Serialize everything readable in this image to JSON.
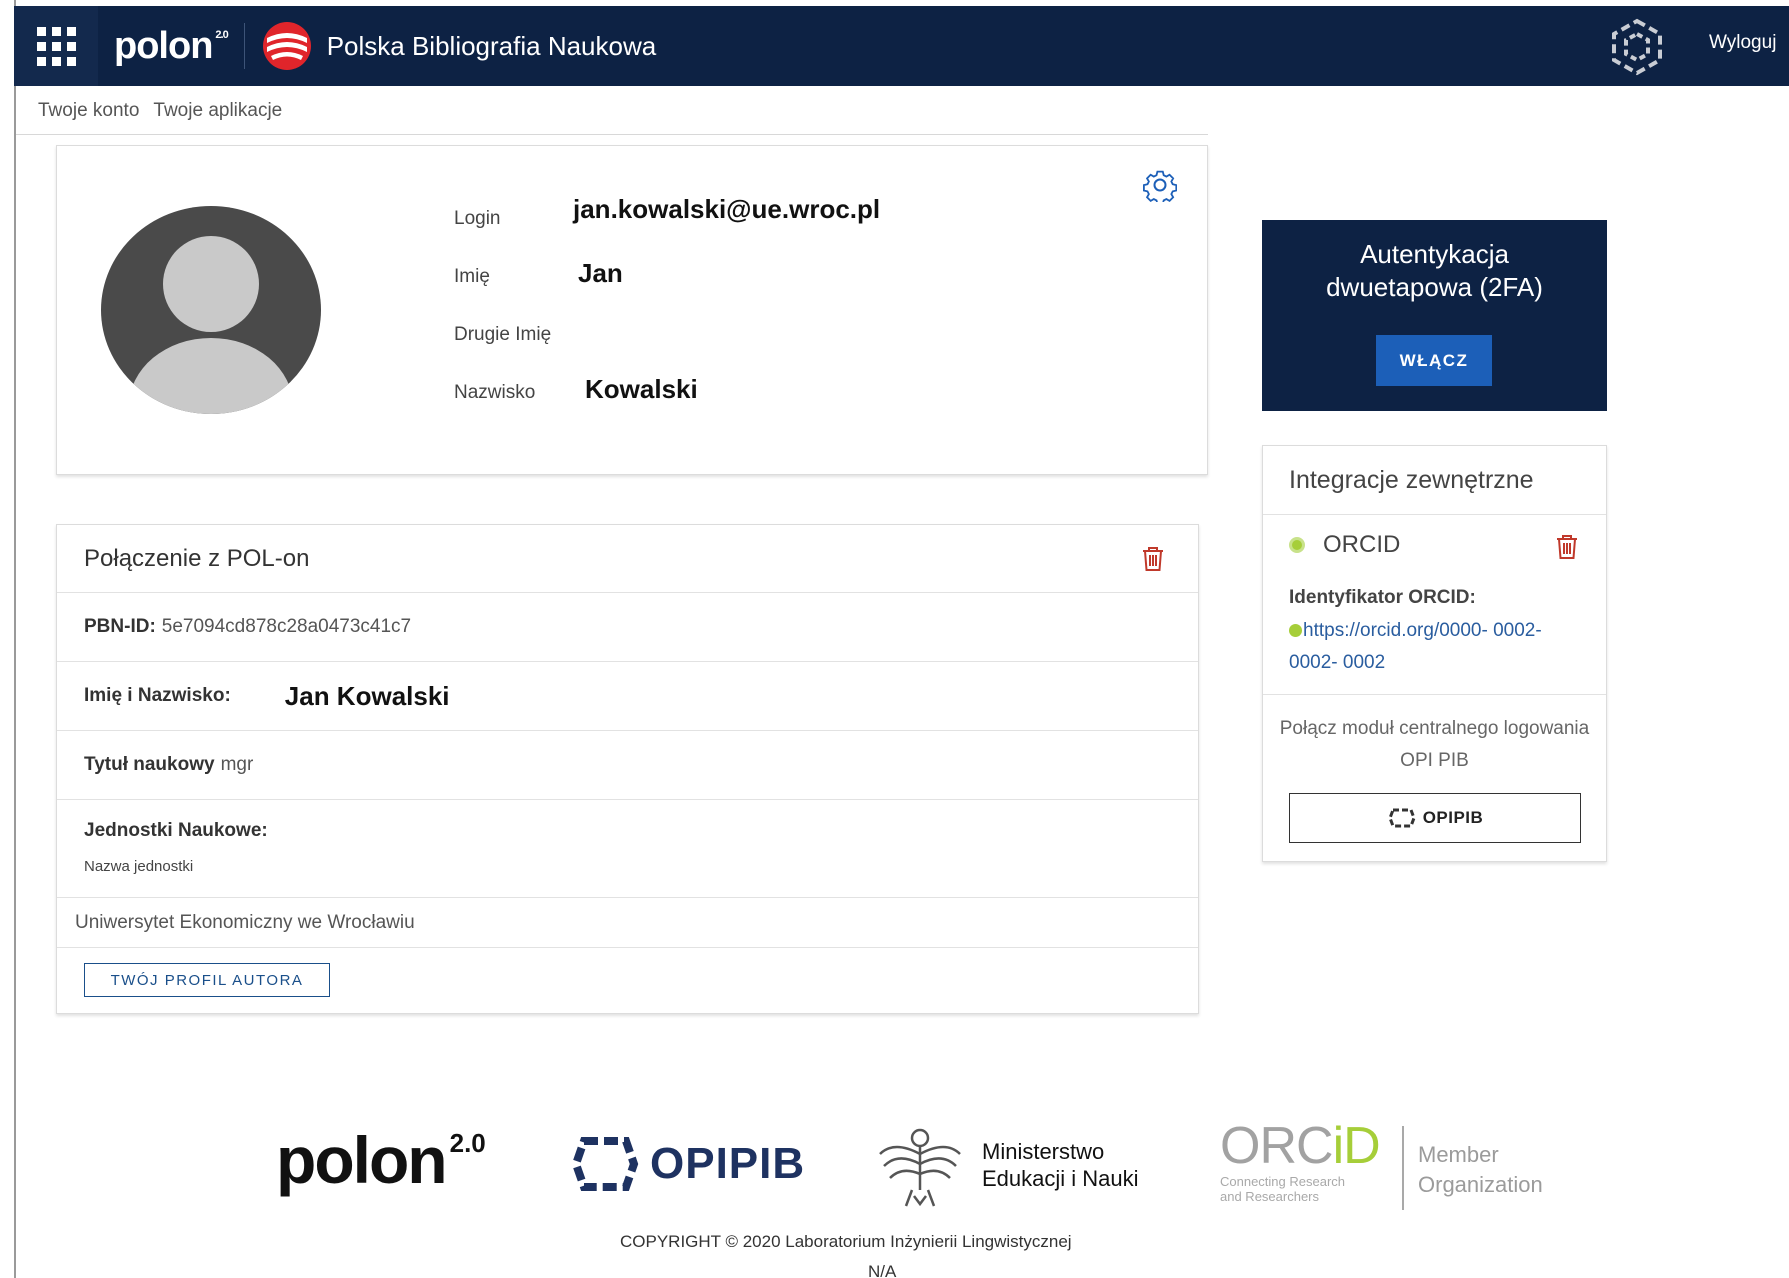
{
  "topbar": {
    "app_logo": "polon",
    "app_logo_version": "2.0",
    "title": "Polska Bibliografia Naukowa",
    "logout_label": "Wyloguj",
    "bg_color": "#0d2244"
  },
  "breadcrumb": [
    "Twoje konto",
    "Twoje aplikacje"
  ],
  "profile": {
    "login_label": "Login",
    "login_value": "jan.kowalski@ue.wroc.pl",
    "first_name_label": "Imię",
    "first_name_value": "Jan",
    "middle_name_label": "Drugie Imię",
    "middle_name_value": "",
    "last_name_label": "Nazwisko",
    "last_name_value": "Kowalski"
  },
  "polon_connection": {
    "title": "Połączenie z POL-on",
    "pbn_id_label": "PBN-ID:",
    "pbn_id_value": "5e7094cd878c28a0473c41c7",
    "full_name_label": "Imię i Nazwisko:",
    "full_name_value": "Jan Kowalski",
    "degree_label": "Tytuł naukowy",
    "degree_value": "mgr",
    "units_label": "Jednostki Naukowe:",
    "units_column": "Nazwa jednostki",
    "unit_name": "Uniwersytet Ekonomiczny we Wrocławiu",
    "profile_button": "TWÓJ PROFIL AUTORA"
  },
  "twofa": {
    "title_line1": "Autentykacja",
    "title_line2": "dwuetapowa (2FA)",
    "button": "WŁĄCZ"
  },
  "integrations": {
    "title": "Integracje zewnętrzne",
    "orcid_name": "ORCID",
    "orcid_id_label": "Identyfikator ORCID:",
    "orcid_url": "https://orcid.org/0000- 0002- 0002- 0002",
    "opi_text": "Połącz moduł centralnego logowania OPI PIB",
    "opi_button": "OPIPIB"
  },
  "footer": {
    "polon": "polon",
    "polon_version": "2.0",
    "opi": "OPIPIB",
    "ministry_line1": "Ministerstwo",
    "ministry_line2": "Edukacji i Nauki",
    "orcid_logo_left": "ORC",
    "orcid_logo_right": "iD",
    "orcid_tagline_line1": "Connecting Research",
    "orcid_tagline_line2": "and Researchers",
    "member_line1": "Member",
    "member_line2": "Organization",
    "copyright": "COPYRIGHT © 2020 Laboratorium Inżynierii Lingwistycznej",
    "version": "N/A"
  },
  "icons": {
    "apps": "apps-grid-icon",
    "pbn": "pbn-logo-icon",
    "hex": "hexagon-logo-icon",
    "gear": "gear-icon",
    "trash": "trash-icon",
    "status": "status-dot-icon"
  },
  "colors": {
    "navy": "#0d2244",
    "primary_button": "#1c5fb8",
    "link": "#2a5d9f",
    "orcid_green": "#a6ce39",
    "danger": "#c0392b"
  }
}
